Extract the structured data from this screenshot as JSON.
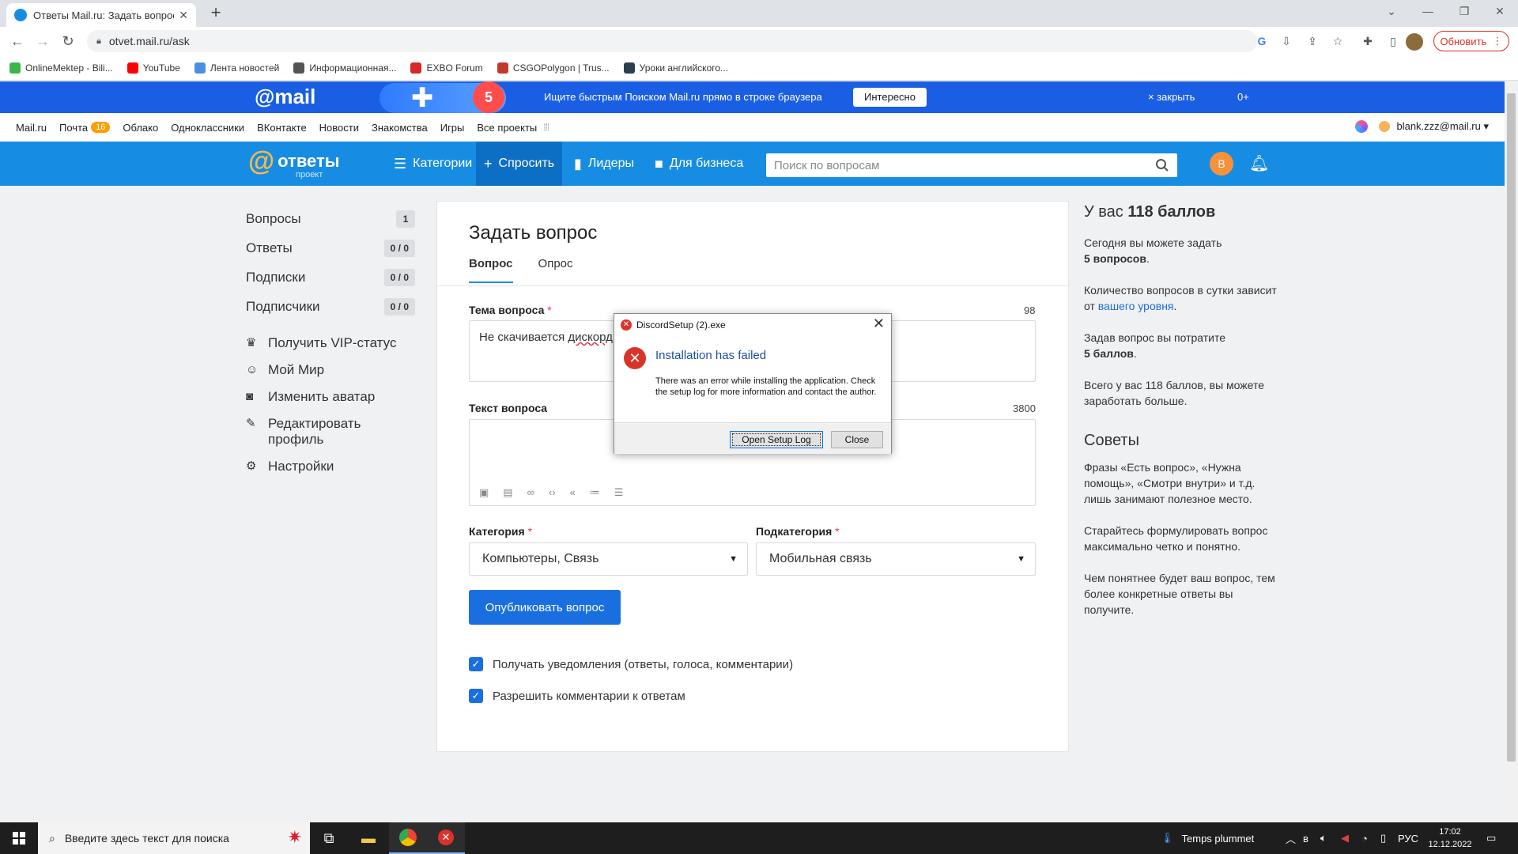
{
  "browser": {
    "tab_title": "Ответы Mail.ru: Задать вопрос",
    "tab_close": "✕",
    "new_tab": "+",
    "url": "otvet.mail.ru/ask",
    "update_button": "Обновить",
    "bookmarks": [
      {
        "label": "OnlineMektep - Bili...",
        "color": "#3cb44b"
      },
      {
        "label": "YouTube",
        "color": "#ff0000"
      },
      {
        "label": "Лента новостей",
        "color": "#4a90e2"
      },
      {
        "label": "Информационная...",
        "color": "#555555"
      },
      {
        "label": "EXBO Forum",
        "color": "#d62828"
      },
      {
        "label": "CSGOPolygon | Trus...",
        "color": "#c0392b"
      },
      {
        "label": "Уроки английского...",
        "color": "#2c3e50"
      }
    ]
  },
  "promo": {
    "logo": "@mail",
    "badge": "5",
    "message": "Ищите быстрым Поиском Mail.ru прямо в строке браузера",
    "cta": "Интересно",
    "close": "× закрыть",
    "age": "0+"
  },
  "portal": {
    "items": [
      "Mail.ru",
      "Почта",
      "Облако",
      "Одноклассники",
      "ВКонтакте",
      "Новости",
      "Знакомства",
      "Игры",
      "Все проекты"
    ],
    "mail_count": "16",
    "user_email": "blank.zzz@mail.ru ▾"
  },
  "header": {
    "brand": "ответы",
    "brand_sub": "проект",
    "nav": [
      {
        "label": "Категории",
        "icon": "☰"
      },
      {
        "label": "Спросить",
        "icon": "+"
      },
      {
        "label": "Лидеры",
        "icon": "▮"
      },
      {
        "label": "Для бизнеса",
        "icon": "■"
      }
    ],
    "search_placeholder": "Поиск по вопросам",
    "avatar_letter": "В"
  },
  "sidebar": {
    "counters": [
      {
        "label": "Вопросы",
        "value": "1"
      },
      {
        "label": "Ответы",
        "value": "0 / 0"
      },
      {
        "label": "Подписки",
        "value": "0 / 0"
      },
      {
        "label": "Подписчики",
        "value": "0 / 0"
      }
    ],
    "actions": [
      {
        "label": "Получить VIP-статус",
        "icon": "♛"
      },
      {
        "label": "Мой Мир",
        "icon": "☺"
      },
      {
        "label": "Изменить аватар",
        "icon": "◙"
      },
      {
        "label": "Редактировать профиль",
        "icon": "✎"
      },
      {
        "label": "Настройки",
        "icon": "⚙"
      }
    ]
  },
  "form": {
    "title": "Задать вопрос",
    "tabs": [
      "Вопрос",
      "Опрос"
    ],
    "topic_label": "Тема вопроса",
    "topic_counter": "98",
    "topic_value_prefix": "Не скачивается ",
    "topic_value_word": "дискорд",
    "text_label": "Текст вопроса",
    "text_counter": "3800",
    "category_label": "Категория",
    "category_value": "Компьютеры, Связь",
    "subcategory_label": "Подкатегория",
    "subcategory_value": "Мобильная связь",
    "required_mark": "*",
    "publish_button": "Опубликовать вопрос",
    "checkboxes": [
      "Получать уведомления (ответы, голоса, комментарии)",
      "Разрешить комментарии к ответам"
    ]
  },
  "right": {
    "points_prefix": "У вас ",
    "points_value": "118 баллов",
    "p1_text": "Сегодня вы можете задать",
    "p1_bold": "5 вопросов",
    "p2_text": "Количество вопросов в сутки зависит от ",
    "p2_link": "вашего уровня",
    "p3_text": "Задав вопрос вы потратите",
    "p3_bold": "5 баллов",
    "p4": "Всего у вас 118 баллов, вы можете заработать больше.",
    "tips_title": "Советы",
    "tips": [
      "Фразы «Есть вопрос», «Нужна помощь», «Смотри внутри» и т.д. лишь занимают полезное место.",
      "Старайтесь формулировать вопрос максимально четко и понятно.",
      "Чем понятнее будет ваш вопрос, тем более конкретные ответы вы получите."
    ]
  },
  "dialog": {
    "window_title": "DiscordSetup (2).exe",
    "heading": "Installation has failed",
    "message": "There was an error while installing the application. Check the setup log for more information and contact the author.",
    "open_log_button": "Open Setup Log",
    "close_button": "Close",
    "error_glyph": "✕"
  },
  "taskbar": {
    "search_placeholder": "Введите здесь текст для поиска",
    "weather": "Temps plummet",
    "language": "РУС",
    "time": "17:02",
    "date": "12.12.2022"
  }
}
